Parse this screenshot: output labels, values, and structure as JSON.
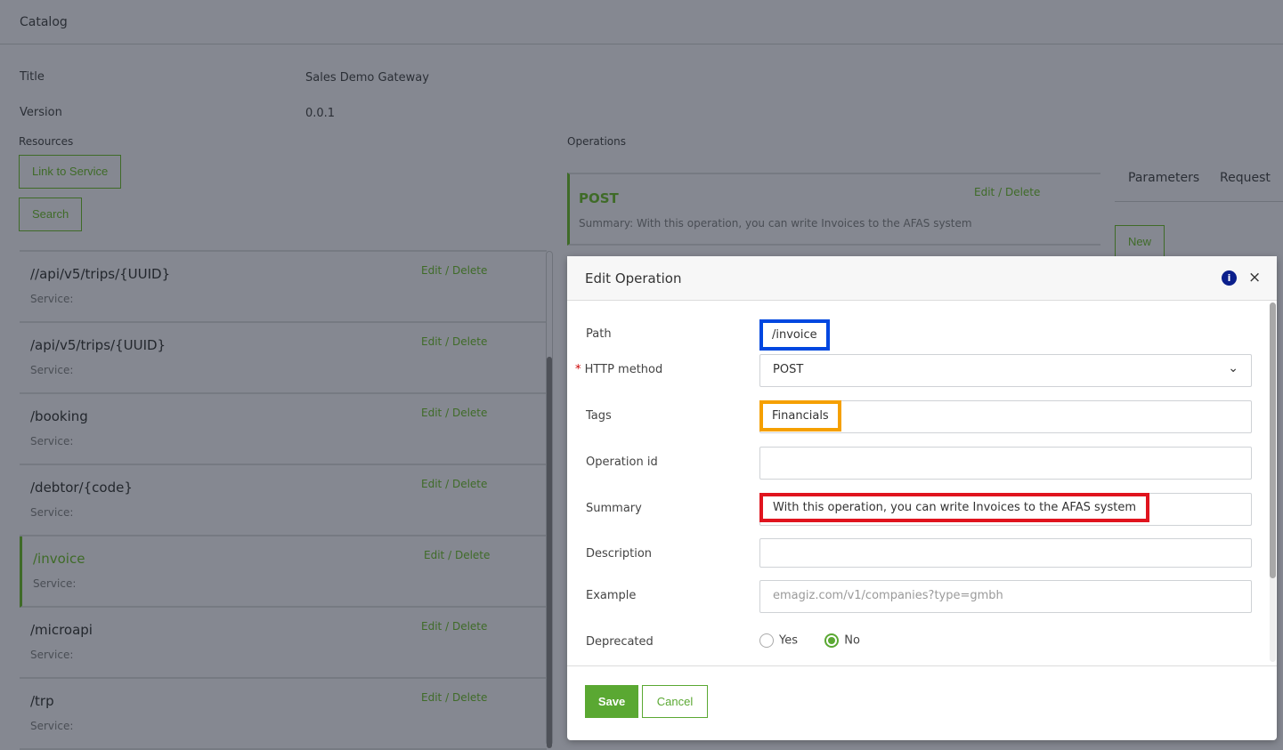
{
  "header": {
    "title": "Catalog"
  },
  "info": {
    "title_label": "Title",
    "title_value": "Sales Demo Gateway",
    "version_label": "Version",
    "version_value": "0.0.1"
  },
  "resources": {
    "label": "Resources",
    "link_button": "Link to Service",
    "search_button": "Search",
    "items": [
      {
        "path": "//api/v5/trips/{UUID}",
        "service": "Service:",
        "edit": "Edit",
        "sep": "/",
        "delete": "Delete"
      },
      {
        "path": "/api/v5/trips/{UUID}",
        "service": "Service:",
        "edit": "Edit",
        "sep": "/",
        "delete": "Delete"
      },
      {
        "path": "/booking",
        "service": "Service:",
        "edit": "Edit",
        "sep": "/",
        "delete": "Delete"
      },
      {
        "path": "/debtor/{code}",
        "service": "Service:",
        "edit": "Edit",
        "sep": "/",
        "delete": "Delete"
      },
      {
        "path": "/invoice",
        "service": "Service:",
        "edit": "Edit",
        "sep": "/",
        "delete": "Delete"
      },
      {
        "path": "/microapi",
        "service": "Service:",
        "edit": "Edit",
        "sep": "/",
        "delete": "Delete"
      },
      {
        "path": "/trp",
        "service": "Service:",
        "edit": "Edit",
        "sep": "/",
        "delete": "Delete"
      }
    ]
  },
  "operations": {
    "label": "Operations",
    "method": "POST",
    "summary": "Summary: With this operation, you can write Invoices to the AFAS system",
    "edit": "Edit",
    "sep": "/",
    "delete": "Delete"
  },
  "tabs": {
    "parameters": "Parameters",
    "request": "Request",
    "new_button": "New"
  },
  "modal": {
    "title": "Edit Operation",
    "close": "×",
    "path_label": "Path",
    "path_value": "/invoice",
    "method_label": "HTTP method",
    "required_mark": "*",
    "method_value": "POST",
    "tags_label": "Tags",
    "tags_value": "Financials",
    "opid_label": "Operation id",
    "opid_value": "",
    "summary_label": "Summary",
    "summary_value": "With this operation, you can write Invoices to the AFAS system",
    "description_label": "Description",
    "description_value": "",
    "example_label": "Example",
    "example_placeholder": "emagiz.com/v1/companies?type=gmbh",
    "deprecated_label": "Deprecated",
    "yes": "Yes",
    "no": "No",
    "deprecated_value": "No",
    "save": "Save",
    "cancel": "Cancel"
  },
  "colors": {
    "accent": "#5aa832",
    "path_highlight": "#0047e0",
    "tags_highlight": "#f5a000",
    "summary_highlight": "#e0141e"
  }
}
